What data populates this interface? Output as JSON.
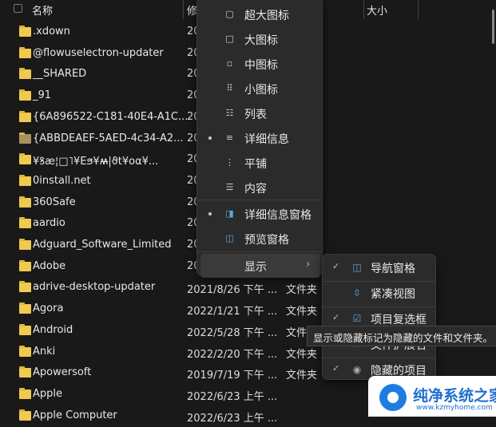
{
  "header": {
    "name": "名称",
    "modified": "修",
    "size": "大小"
  },
  "files": [
    {
      "name": ".xdown",
      "date": "20",
      "type": ""
    },
    {
      "name": "@flowuselectron-updater",
      "date": "20",
      "type": ""
    },
    {
      "name": "__SHARED",
      "date": "20",
      "type": ""
    },
    {
      "name": "_91",
      "date": "20",
      "type": ""
    },
    {
      "name": "{6A896522-C181-40E4-A1C...",
      "date": "20",
      "type": ""
    },
    {
      "name": "{ABBDEAEF-5AED-4c34-A2...",
      "date": "20",
      "type": ""
    },
    {
      "name": "¥ꝸæ¦□˥¥Eϧ¥ʍ̶|ϑt¥oα¥...",
      "date": "20",
      "type": ""
    },
    {
      "name": "0install.net",
      "date": "20",
      "type": ""
    },
    {
      "name": "360Safe",
      "date": "20",
      "type": ""
    },
    {
      "name": "aardio",
      "date": "20",
      "type": ""
    },
    {
      "name": "Adguard_Software_Limited",
      "date": "20",
      "type": ""
    },
    {
      "name": "Adobe",
      "date": "20",
      "type": ""
    },
    {
      "name": "adrive-desktop-updater",
      "date": "2021/8/26 下午 ...",
      "type": "文件夹"
    },
    {
      "name": "Agora",
      "date": "2022/1/21 下午 ...",
      "type": "文件夹"
    },
    {
      "name": "Android",
      "date": "2022/5/28 下午 ...",
      "type": "文件"
    },
    {
      "name": "Anki",
      "date": "2022/2/20 下午 ...",
      "type": "文件夹"
    },
    {
      "name": "Apowersoft",
      "date": "2019/7/19 下午 ...",
      "type": "文件夹"
    },
    {
      "name": "Apple",
      "date": "2022/6/23 上午 ...",
      "type": ""
    },
    {
      "name": "Apple Computer",
      "date": "2022/6/23 上午 ...",
      "type": ""
    }
  ],
  "view_menu": {
    "items": [
      {
        "label": "超大图标",
        "icon": "extra-large-icons-icon"
      },
      {
        "label": "大图标",
        "icon": "large-icons-icon"
      },
      {
        "label": "中图标",
        "icon": "medium-icons-icon"
      },
      {
        "label": "小图标",
        "icon": "small-icons-icon"
      },
      {
        "label": "列表",
        "icon": "list-icon"
      },
      {
        "label": "详细信息",
        "icon": "details-icon",
        "selected": true
      },
      {
        "label": "平铺",
        "icon": "tiles-icon"
      },
      {
        "label": "内容",
        "icon": "content-icon"
      }
    ],
    "panes": [
      {
        "label": "详细信息窗格",
        "icon": "details-pane-icon",
        "selected": true
      },
      {
        "label": "预览窗格",
        "icon": "preview-pane-icon"
      }
    ],
    "show": "显示"
  },
  "show_submenu": [
    {
      "label": "导航窗格",
      "checked": true,
      "icon": "navigation-pane-icon"
    },
    {
      "label": "紧凑视图",
      "checked": false,
      "icon": "compact-view-icon"
    },
    {
      "label": "项目复选框",
      "checked": true,
      "icon": "item-checkbox-icon"
    },
    {
      "label": "文件扩展名",
      "checked": true,
      "icon": "file-extension-icon"
    },
    {
      "label": "隐藏的项目",
      "checked": true,
      "icon": "eye-icon"
    }
  ],
  "tooltip": "显示或隐藏标记为隐藏的文件和文件夹。",
  "watermark": {
    "title": "纯净系统之家",
    "url": "www.kzmyhome.com"
  },
  "colors": {
    "folder": "#f0c94f",
    "accent": "#5aa7e0",
    "background": "#191919"
  }
}
